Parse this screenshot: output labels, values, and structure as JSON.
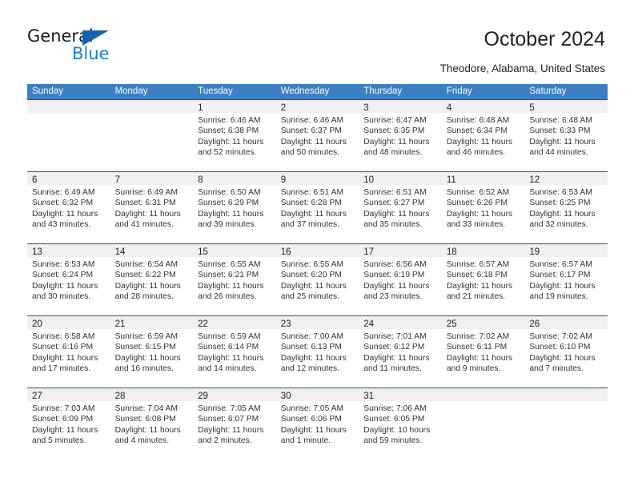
{
  "brand": {
    "name_part1": "General",
    "name_part2": "Blue",
    "triangle_color": "#1262ac",
    "blue_color": "#1c7fd4"
  },
  "header": {
    "title": "October 2024",
    "subtitle": "Theodore, Alabama, United States"
  },
  "theme": {
    "header_blue": "#3b7fc4",
    "row_border_blue": "#15569e",
    "day_band_gray": "#f0f0f0"
  },
  "calendar": {
    "weekday_headers": [
      "Sunday",
      "Monday",
      "Tuesday",
      "Wednesday",
      "Thursday",
      "Friday",
      "Saturday"
    ],
    "weeks": [
      [
        {
          "day": "",
          "empty": true
        },
        {
          "day": "",
          "empty": true
        },
        {
          "day": "1",
          "sunrise": "Sunrise: 6:46 AM",
          "sunset": "Sunset: 6:38 PM",
          "daylight": "Daylight: 11 hours and 52 minutes."
        },
        {
          "day": "2",
          "sunrise": "Sunrise: 6:46 AM",
          "sunset": "Sunset: 6:37 PM",
          "daylight": "Daylight: 11 hours and 50 minutes."
        },
        {
          "day": "3",
          "sunrise": "Sunrise: 6:47 AM",
          "sunset": "Sunset: 6:35 PM",
          "daylight": "Daylight: 11 hours and 48 minutes."
        },
        {
          "day": "4",
          "sunrise": "Sunrise: 6:48 AM",
          "sunset": "Sunset: 6:34 PM",
          "daylight": "Daylight: 11 hours and 46 minutes."
        },
        {
          "day": "5",
          "sunrise": "Sunrise: 6:48 AM",
          "sunset": "Sunset: 6:33 PM",
          "daylight": "Daylight: 11 hours and 44 minutes."
        }
      ],
      [
        {
          "day": "6",
          "sunrise": "Sunrise: 6:49 AM",
          "sunset": "Sunset: 6:32 PM",
          "daylight": "Daylight: 11 hours and 43 minutes."
        },
        {
          "day": "7",
          "sunrise": "Sunrise: 6:49 AM",
          "sunset": "Sunset: 6:31 PM",
          "daylight": "Daylight: 11 hours and 41 minutes."
        },
        {
          "day": "8",
          "sunrise": "Sunrise: 6:50 AM",
          "sunset": "Sunset: 6:29 PM",
          "daylight": "Daylight: 11 hours and 39 minutes."
        },
        {
          "day": "9",
          "sunrise": "Sunrise: 6:51 AM",
          "sunset": "Sunset: 6:28 PM",
          "daylight": "Daylight: 11 hours and 37 minutes."
        },
        {
          "day": "10",
          "sunrise": "Sunrise: 6:51 AM",
          "sunset": "Sunset: 6:27 PM",
          "daylight": "Daylight: 11 hours and 35 minutes."
        },
        {
          "day": "11",
          "sunrise": "Sunrise: 6:52 AM",
          "sunset": "Sunset: 6:26 PM",
          "daylight": "Daylight: 11 hours and 33 minutes."
        },
        {
          "day": "12",
          "sunrise": "Sunrise: 6:53 AM",
          "sunset": "Sunset: 6:25 PM",
          "daylight": "Daylight: 11 hours and 32 minutes."
        }
      ],
      [
        {
          "day": "13",
          "sunrise": "Sunrise: 6:53 AM",
          "sunset": "Sunset: 6:24 PM",
          "daylight": "Daylight: 11 hours and 30 minutes."
        },
        {
          "day": "14",
          "sunrise": "Sunrise: 6:54 AM",
          "sunset": "Sunset: 6:22 PM",
          "daylight": "Daylight: 11 hours and 28 minutes."
        },
        {
          "day": "15",
          "sunrise": "Sunrise: 6:55 AM",
          "sunset": "Sunset: 6:21 PM",
          "daylight": "Daylight: 11 hours and 26 minutes."
        },
        {
          "day": "16",
          "sunrise": "Sunrise: 6:55 AM",
          "sunset": "Sunset: 6:20 PM",
          "daylight": "Daylight: 11 hours and 25 minutes."
        },
        {
          "day": "17",
          "sunrise": "Sunrise: 6:56 AM",
          "sunset": "Sunset: 6:19 PM",
          "daylight": "Daylight: 11 hours and 23 minutes."
        },
        {
          "day": "18",
          "sunrise": "Sunrise: 6:57 AM",
          "sunset": "Sunset: 6:18 PM",
          "daylight": "Daylight: 11 hours and 21 minutes."
        },
        {
          "day": "19",
          "sunrise": "Sunrise: 6:57 AM",
          "sunset": "Sunset: 6:17 PM",
          "daylight": "Daylight: 11 hours and 19 minutes."
        }
      ],
      [
        {
          "day": "20",
          "sunrise": "Sunrise: 6:58 AM",
          "sunset": "Sunset: 6:16 PM",
          "daylight": "Daylight: 11 hours and 17 minutes."
        },
        {
          "day": "21",
          "sunrise": "Sunrise: 6:59 AM",
          "sunset": "Sunset: 6:15 PM",
          "daylight": "Daylight: 11 hours and 16 minutes."
        },
        {
          "day": "22",
          "sunrise": "Sunrise: 6:59 AM",
          "sunset": "Sunset: 6:14 PM",
          "daylight": "Daylight: 11 hours and 14 minutes."
        },
        {
          "day": "23",
          "sunrise": "Sunrise: 7:00 AM",
          "sunset": "Sunset: 6:13 PM",
          "daylight": "Daylight: 11 hours and 12 minutes."
        },
        {
          "day": "24",
          "sunrise": "Sunrise: 7:01 AM",
          "sunset": "Sunset: 6:12 PM",
          "daylight": "Daylight: 11 hours and 11 minutes."
        },
        {
          "day": "25",
          "sunrise": "Sunrise: 7:02 AM",
          "sunset": "Sunset: 6:11 PM",
          "daylight": "Daylight: 11 hours and 9 minutes."
        },
        {
          "day": "26",
          "sunrise": "Sunrise: 7:02 AM",
          "sunset": "Sunset: 6:10 PM",
          "daylight": "Daylight: 11 hours and 7 minutes."
        }
      ],
      [
        {
          "day": "27",
          "sunrise": "Sunrise: 7:03 AM",
          "sunset": "Sunset: 6:09 PM",
          "daylight": "Daylight: 11 hours and 5 minutes."
        },
        {
          "day": "28",
          "sunrise": "Sunrise: 7:04 AM",
          "sunset": "Sunset: 6:08 PM",
          "daylight": "Daylight: 11 hours and 4 minutes."
        },
        {
          "day": "29",
          "sunrise": "Sunrise: 7:05 AM",
          "sunset": "Sunset: 6:07 PM",
          "daylight": "Daylight: 11 hours and 2 minutes."
        },
        {
          "day": "30",
          "sunrise": "Sunrise: 7:05 AM",
          "sunset": "Sunset: 6:06 PM",
          "daylight": "Daylight: 11 hours and 1 minute."
        },
        {
          "day": "31",
          "sunrise": "Sunrise: 7:06 AM",
          "sunset": "Sunset: 6:05 PM",
          "daylight": "Daylight: 10 hours and 59 minutes."
        },
        {
          "day": "",
          "empty": true
        },
        {
          "day": "",
          "empty": true
        }
      ]
    ]
  }
}
